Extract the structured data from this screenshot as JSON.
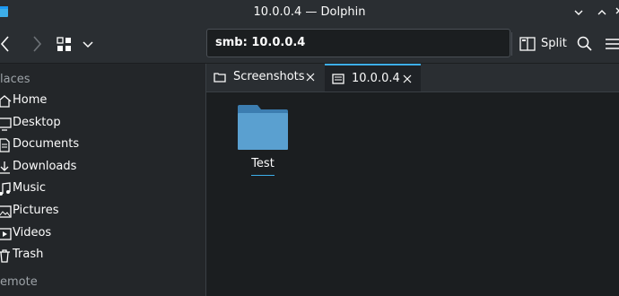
{
  "window": {
    "title": "10.0.0.4 — Dolphin"
  },
  "toolbar": {
    "location": "smb: 10.0.0.4",
    "split_label": "Split",
    "back_icon": "chevron-left-icon",
    "forward_icon": "chevron-right-icon",
    "view_mode_icon": "icons-view-icon",
    "search_icon": "search-icon",
    "menu_icon": "hamburger-menu-icon"
  },
  "sidebar": {
    "places_heading": "laces",
    "remote_heading": "emote",
    "items": [
      {
        "label": "Home",
        "icon": "home-icon"
      },
      {
        "label": "Desktop",
        "icon": "desktop-icon"
      },
      {
        "label": "Documents",
        "icon": "documents-icon"
      },
      {
        "label": "Downloads",
        "icon": "downloads-icon"
      },
      {
        "label": "Music",
        "icon": "music-icon"
      },
      {
        "label": "Pictures",
        "icon": "pictures-icon"
      },
      {
        "label": "Videos",
        "icon": "videos-icon"
      },
      {
        "label": "Trash",
        "icon": "trash-icon"
      }
    ]
  },
  "tabs": [
    {
      "label": "Screenshots",
      "active": false
    },
    {
      "label": "10.0.0.4",
      "active": true
    }
  ],
  "files": [
    {
      "name": "Test",
      "type": "folder"
    }
  ],
  "colors": {
    "accent": "#3daee9",
    "folder": "#5aa0d0",
    "background": "#1b1e20",
    "sidebar": "#232629"
  }
}
